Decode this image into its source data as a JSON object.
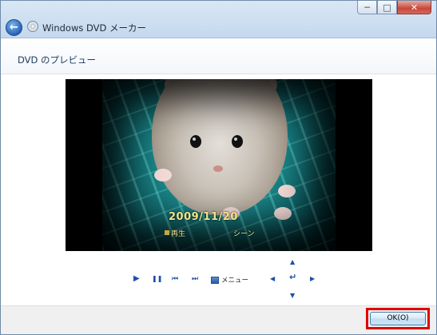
{
  "window": {
    "title": "Windows DVD メーカー",
    "controls": {
      "minimize": "─",
      "maximize": "□",
      "close": "✕"
    }
  },
  "header": {
    "page_title": "DVD のプレビュー"
  },
  "preview": {
    "overlay_date": "2009/11/20",
    "overlay_play": "再生",
    "overlay_scene": "シーン"
  },
  "transport": {
    "play_icon": "▶",
    "pause_icon": "❚❚",
    "prev_icon": "⏮",
    "next_icon": "⏭",
    "menu_label": "メニュー",
    "up_icon": "▲",
    "down_icon": "▼",
    "left_icon": "◀",
    "right_icon": "▶",
    "enter_icon": "↵"
  },
  "footer": {
    "ok_label": "OK(O)"
  },
  "colors": {
    "accent": "#1d4fa8",
    "highlight": "#e00000",
    "osd_text": "#f1e48a"
  }
}
